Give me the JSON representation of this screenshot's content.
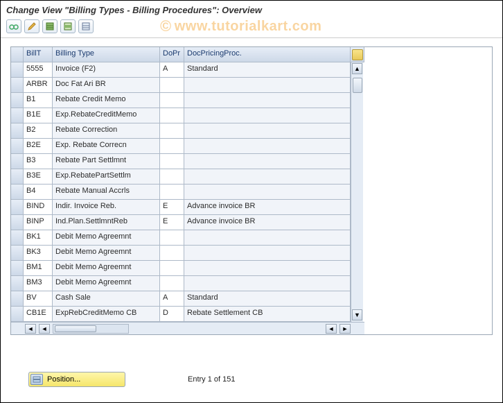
{
  "title": "Change View \"Billing Types - Billing Procedures\": Overview",
  "watermark": "www.tutorialkart.com",
  "toolbar": {
    "other_view": "Other view",
    "change": "Change",
    "select_all": "Select all",
    "select_block": "Select block",
    "deselect": "Deselect"
  },
  "columns": {
    "billt": "BillT",
    "btype": "Billing Type",
    "dopr": "DoPr",
    "dpp": "DocPricingProc."
  },
  "rows": [
    {
      "billt": "5555",
      "btype": "Invoice (F2)",
      "dopr": "A",
      "dpp": "Standard"
    },
    {
      "billt": "ARBR",
      "btype": "Doc Fat Ari BR",
      "dopr": "",
      "dpp": ""
    },
    {
      "billt": "B1",
      "btype": "Rebate Credit Memo",
      "dopr": "",
      "dpp": ""
    },
    {
      "billt": "B1E",
      "btype": "Exp.RebateCreditMemo",
      "dopr": "",
      "dpp": ""
    },
    {
      "billt": "B2",
      "btype": "Rebate Correction",
      "dopr": "",
      "dpp": ""
    },
    {
      "billt": "B2E",
      "btype": "Exp. Rebate Correcn",
      "dopr": "",
      "dpp": ""
    },
    {
      "billt": "B3",
      "btype": "Rebate Part Settlmnt",
      "dopr": "",
      "dpp": ""
    },
    {
      "billt": "B3E",
      "btype": "Exp.RebatePartSettlm",
      "dopr": "",
      "dpp": ""
    },
    {
      "billt": "B4",
      "btype": "Rebate Manual Accrls",
      "dopr": "",
      "dpp": ""
    },
    {
      "billt": "BIND",
      "btype": "Indir. Invoice Reb.",
      "dopr": "E",
      "dpp": "Advance invoice BR"
    },
    {
      "billt": "BINP",
      "btype": "Ind.Plan.SettlmntReb",
      "dopr": "E",
      "dpp": "Advance invoice BR"
    },
    {
      "billt": "BK1",
      "btype": "Debit Memo Agreemnt",
      "dopr": "",
      "dpp": ""
    },
    {
      "billt": "BK3",
      "btype": "Debit Memo Agreemnt",
      "dopr": "",
      "dpp": ""
    },
    {
      "billt": "BM1",
      "btype": "Debit Memo Agreemnt",
      "dopr": "",
      "dpp": ""
    },
    {
      "billt": "BM3",
      "btype": "Debit Memo Agreemnt",
      "dopr": "",
      "dpp": ""
    },
    {
      "billt": "BV",
      "btype": "Cash Sale",
      "dopr": "A",
      "dpp": "Standard"
    },
    {
      "billt": "CB1E",
      "btype": "ExpRebCreditMemo CB",
      "dopr": "D",
      "dpp": "Rebate Settlement CB"
    }
  ],
  "position_button": "Position...",
  "entry_text": "Entry 1 of 151"
}
